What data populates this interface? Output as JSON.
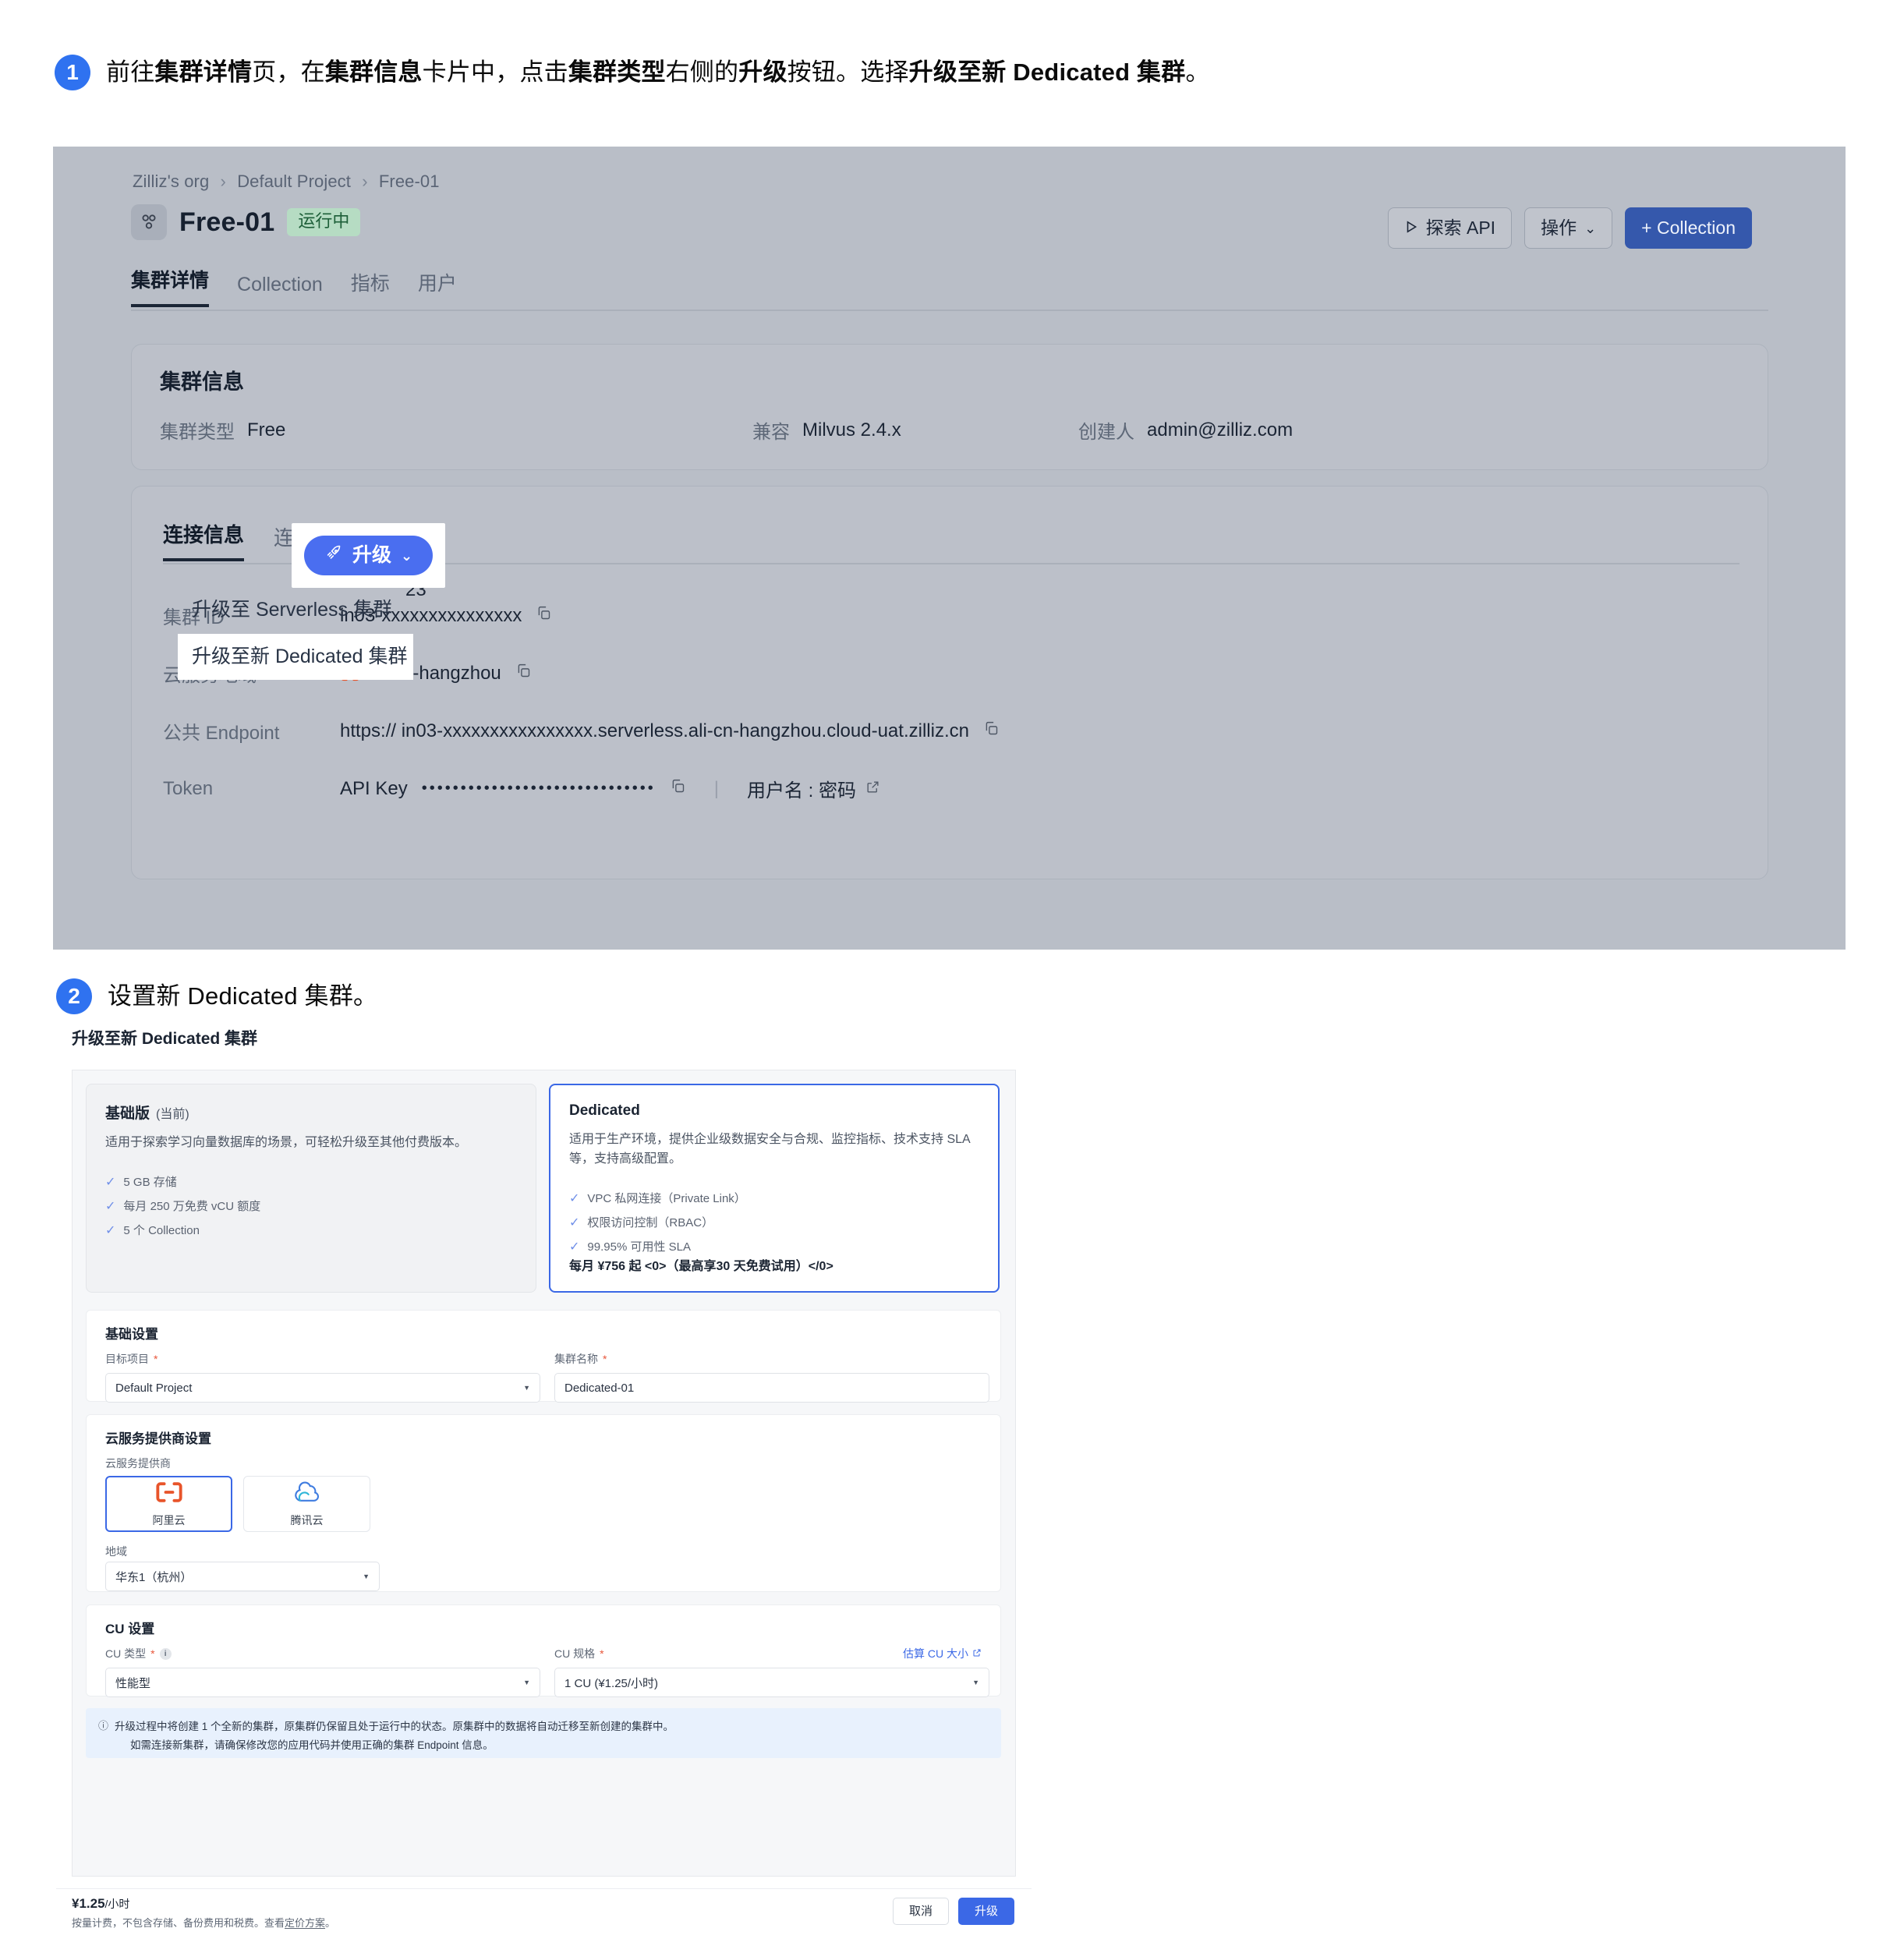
{
  "steps": [
    {
      "number": "1",
      "segments": [
        {
          "t": "前往",
          "b": false
        },
        {
          "t": "集群详情",
          "b": true
        },
        {
          "t": "页，在",
          "b": false
        },
        {
          "t": "集群信息",
          "b": true
        },
        {
          "t": "卡片中，点击",
          "b": false
        },
        {
          "t": "集群类型",
          "b": true
        },
        {
          "t": "右侧的",
          "b": false
        },
        {
          "t": "升级",
          "b": true
        },
        {
          "t": "按钮。选择",
          "b": false
        },
        {
          "t": "升级至新 Dedicated 集群",
          "b": true
        },
        {
          "t": "。",
          "b": false
        }
      ]
    },
    {
      "number": "2",
      "segments": [
        {
          "t": "设置新 Dedicated 集群。",
          "b": false
        }
      ]
    }
  ],
  "app": {
    "breadcrumb": [
      "Zilliz's org",
      "Default Project",
      "Free-01"
    ],
    "breadcrumb_separator": "›",
    "cluster_name": "Free-01",
    "status_badge": "运行中",
    "header_buttons": {
      "explore_api": "探索 API",
      "explore_api_icon": "play-triangle-icon",
      "actions": "操作",
      "actions_caret": "⌄",
      "create_collection": "+ Collection"
    },
    "tabs": [
      {
        "label": "集群详情",
        "active": true
      },
      {
        "label": "Collection",
        "active": false
      },
      {
        "label": "指标",
        "active": false
      },
      {
        "label": "用户",
        "active": false
      }
    ],
    "info_card": {
      "title": "集群信息",
      "cluster_type_label": "集群类型",
      "cluster_type_value": "Free",
      "upgrade_button": "升级",
      "upgrade_caret": "⌄",
      "upgrade_menu": [
        {
          "label": "升级至 Serverless 集群",
          "highlighted": false
        },
        {
          "label": "升级至新 Dedicated 集群",
          "highlighted": true
        }
      ],
      "compat_label": "兼容",
      "compat_value": "Milvus 2.4.x",
      "owner_label": "创建人",
      "owner_value": "admin@zilliz.com",
      "obscured_value": "23"
    },
    "conn_card": {
      "tabs": [
        {
          "label": "连接信息",
          "active": true
        },
        {
          "label": "连接指南",
          "active": false
        }
      ],
      "rows": [
        {
          "key": "集群 ID",
          "value": "in03-xxxxxxxxxxxxxxx",
          "copy": true
        },
        {
          "key": "云服务地域",
          "value": "ali-cn-hangzhou",
          "copy": true,
          "icon": "aliyun-icon"
        },
        {
          "key": "公共 Endpoint",
          "value": "https:// in03-xxxxxxxxxxxxxxxx.serverless.ali-cn-hangzhou.cloud-uat.zilliz.cn",
          "copy": true
        }
      ],
      "token_row": {
        "key": "Token",
        "api_key_label": "API Key",
        "masked": "••••••••••••••••••••••••••••••",
        "separator": "|",
        "user_pass_label": "用户名 : 密码",
        "external_icon": "external-link-icon"
      }
    }
  },
  "dialog": {
    "title": "升级至新 Dedicated 集群",
    "plans": [
      {
        "name": "基础版",
        "current_tag": "(当前)",
        "description": "适用于探索学习向量数据库的场景，可轻松升级至其他付费版本。",
        "features": [
          "5 GB 存储",
          "每月 250 万免费 vCU 额度",
          "5 个 Collection"
        ],
        "price": "",
        "selected": false
      },
      {
        "name": "Dedicated",
        "current_tag": "",
        "description": "适用于生产环境，提供企业级数据安全与合规、监控指标、技术支持 SLA 等，支持高级配置。",
        "features": [
          "VPC 私网连接（Private Link）",
          "权限访问控制（RBAC）",
          "99.95% 可用性 SLA"
        ],
        "price": "每月 ¥756 起 <0>（最高享30 天免费试用）</0>",
        "selected": true
      }
    ],
    "basic_settings": {
      "title": "基础设置",
      "project_label": "目标项目",
      "project_value": "Default Project",
      "cluster_name_label": "集群名称",
      "cluster_name_value": "Dedicated-01"
    },
    "cloud_settings": {
      "title": "云服务提供商设置",
      "provider_label": "云服务提供商",
      "providers": [
        {
          "name": "阿里云",
          "icon": "aliyun-icon",
          "selected": true
        },
        {
          "name": "腾讯云",
          "icon": "tencent-cloud-icon",
          "selected": false
        }
      ],
      "region_label": "地域",
      "region_value": "华东1（杭州）"
    },
    "cu_settings": {
      "title": "CU 设置",
      "cu_type_label": "CU 类型",
      "cu_type_value": "性能型",
      "cu_spec_label": "CU 规格",
      "cu_spec_value": "1 CU (¥1.25/小时)",
      "estimate_link": "估算 CU 大小",
      "estimate_icon": "external-link-icon",
      "info_icon": "info-icon"
    },
    "notice": {
      "icon": "info-circle-icon",
      "line1": "升级过程中将创建 1 个全新的集群，原集群仍保留且处于运行中的状态。原集群中的数据将自动迁移至新创建的集群中。",
      "line2": "如需连接新集群，请确保修改您的应用代码并使用正确的集群 Endpoint 信息。"
    },
    "footer": {
      "price": "¥1.25",
      "price_unit": "/小时",
      "note_prefix": "按量计费，不包含存储、备份费用和税费。查看",
      "note_link": "定价方案",
      "note_suffix": "。",
      "cancel": "取消",
      "confirm": "升级"
    }
  },
  "colors": {
    "accent_blue": "#3b68e6",
    "upgrade_blue": "#4a6ef0",
    "primary_btn": "#3558ac",
    "app_bg": "#b9bec7",
    "status_green_bg": "#b6dcc3",
    "status_green_fg": "#1d5e38",
    "aliyun_orange": "#e8542a",
    "notice_bg": "#e8f1fd",
    "required_red": "#e8563a"
  }
}
